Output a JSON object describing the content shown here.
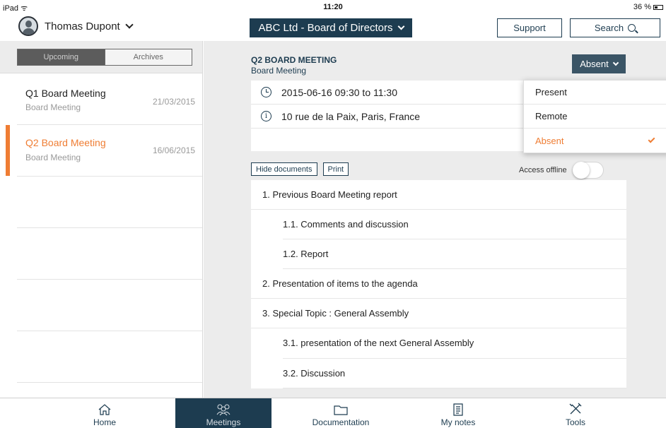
{
  "status": {
    "device": "iPad",
    "time": "11:20",
    "battery": "36 %"
  },
  "header": {
    "user_name": "Thomas Dupont",
    "board": "ABC Ltd - Board of Directors",
    "support": "Support",
    "search": "Search"
  },
  "sidebar": {
    "tabs": [
      "Upcoming",
      "Archives"
    ],
    "meetings": [
      {
        "title": "Q1 Board Meeting",
        "subtitle": "Board Meeting",
        "date": "21/03/2015"
      },
      {
        "title": "Q2 Board Meeting",
        "subtitle": "Board Meeting",
        "date": "16/06/2015"
      }
    ]
  },
  "meeting": {
    "title": "Q2 BOARD MEETING",
    "subtitle": "Board Meeting",
    "attendance": "Absent",
    "datetime": "2015-06-16 09:30 to 11:30",
    "location": "10 rue de la Paix, Paris, France"
  },
  "documents": {
    "hide_label": "Hide documents",
    "print_label": "Print",
    "offline_label": "Access offline",
    "offline_on": false
  },
  "agenda": [
    "1. Previous Board Meeting report",
    "1.1. Comments and discussion",
    "1.2. Report",
    "2. Presentation of items to the agenda",
    "3. Special Topic : General Assembly",
    "3.1. presentation of the next General Assembly",
    "3.2. Discussion"
  ],
  "attendance_menu": [
    "Present",
    "Remote",
    "Absent"
  ],
  "tabbar": [
    "Home",
    "Meetings",
    "Documentation",
    "My notes",
    "Tools"
  ],
  "colors": {
    "navy": "#1d3c50",
    "accent": "#ef7d33"
  }
}
